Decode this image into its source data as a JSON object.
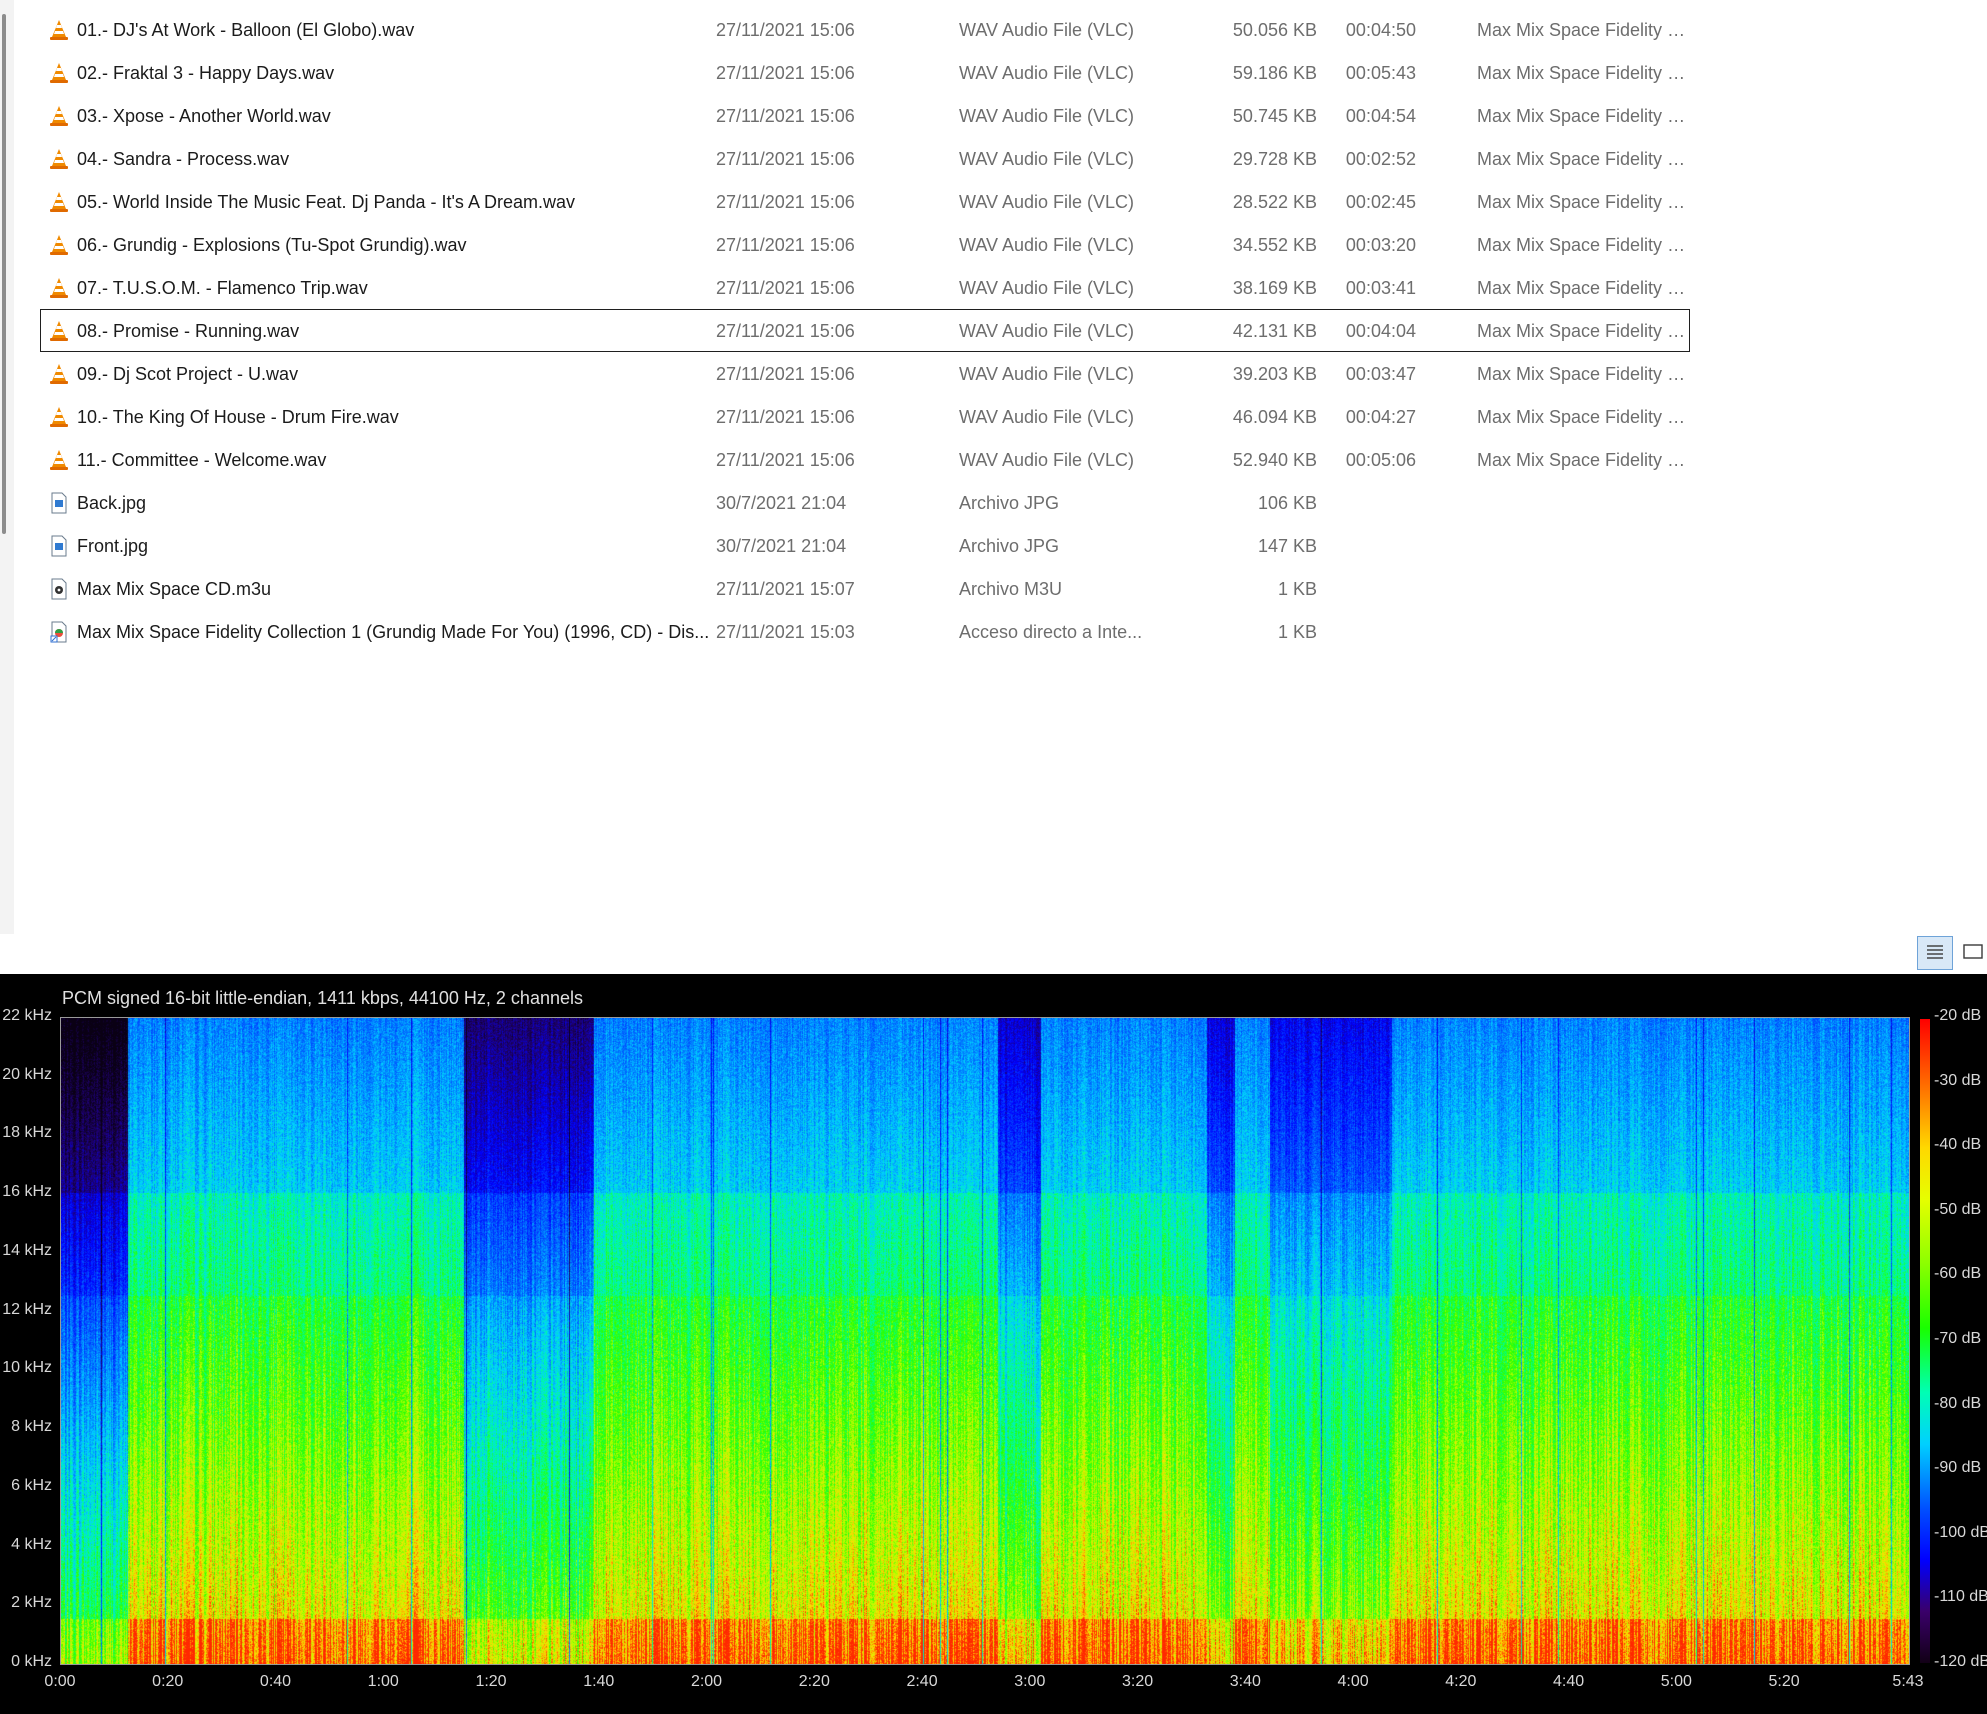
{
  "files": [
    {
      "icon": "vlc-cone-icon",
      "name": "01.- DJ's At Work - Balloon (El Globo).wav",
      "date": "27/11/2021 15:06",
      "type": "WAV Audio File (VLC)",
      "size": "50.056 KB",
      "duration": "00:04:50",
      "album": "Max Mix Space Fidelity C..."
    },
    {
      "icon": "vlc-cone-icon",
      "name": "02.- Fraktal 3 - Happy Days.wav",
      "date": "27/11/2021 15:06",
      "type": "WAV Audio File (VLC)",
      "size": "59.186 KB",
      "duration": "00:05:43",
      "album": "Max Mix Space Fidelity C..."
    },
    {
      "icon": "vlc-cone-icon",
      "name": "03.- Xpose - Another World.wav",
      "date": "27/11/2021 15:06",
      "type": "WAV Audio File (VLC)",
      "size": "50.745 KB",
      "duration": "00:04:54",
      "album": "Max Mix Space Fidelity C..."
    },
    {
      "icon": "vlc-cone-icon",
      "name": "04.- Sandra - Process.wav",
      "date": "27/11/2021 15:06",
      "type": "WAV Audio File (VLC)",
      "size": "29.728 KB",
      "duration": "00:02:52",
      "album": "Max Mix Space Fidelity C..."
    },
    {
      "icon": "vlc-cone-icon",
      "name": "05.- World Inside The Music Feat. Dj Panda - It's A Dream.wav",
      "date": "27/11/2021 15:06",
      "type": "WAV Audio File (VLC)",
      "size": "28.522 KB",
      "duration": "00:02:45",
      "album": "Max Mix Space Fidelity C..."
    },
    {
      "icon": "vlc-cone-icon",
      "name": "06.- Grundig - Explosions (Tu-Spot Grundig).wav",
      "date": "27/11/2021 15:06",
      "type": "WAV Audio File (VLC)",
      "size": "34.552 KB",
      "duration": "00:03:20",
      "album": "Max Mix Space Fidelity C..."
    },
    {
      "icon": "vlc-cone-icon",
      "name": "07.- T.U.S.O.M. - Flamenco Trip.wav",
      "date": "27/11/2021 15:06",
      "type": "WAV Audio File (VLC)",
      "size": "38.169 KB",
      "duration": "00:03:41",
      "album": "Max Mix Space Fidelity C..."
    },
    {
      "icon": "vlc-cone-icon",
      "name": "08.- Promise - Running.wav",
      "date": "27/11/2021 15:06",
      "type": "WAV Audio File (VLC)",
      "size": "42.131 KB",
      "duration": "00:04:04",
      "album": "Max Mix Space Fidelity C...",
      "selected": true
    },
    {
      "icon": "vlc-cone-icon",
      "name": "09.- Dj Scot Project - U.wav",
      "date": "27/11/2021 15:06",
      "type": "WAV Audio File (VLC)",
      "size": "39.203 KB",
      "duration": "00:03:47",
      "album": "Max Mix Space Fidelity C..."
    },
    {
      "icon": "vlc-cone-icon",
      "name": "10.- The King Of House - Drum Fire.wav",
      "date": "27/11/2021 15:06",
      "type": "WAV Audio File (VLC)",
      "size": "46.094 KB",
      "duration": "00:04:27",
      "album": "Max Mix Space Fidelity C..."
    },
    {
      "icon": "vlc-cone-icon",
      "name": "11.- Committee - Welcome.wav",
      "date": "27/11/2021 15:06",
      "type": "WAV Audio File (VLC)",
      "size": "52.940 KB",
      "duration": "00:05:06",
      "album": "Max Mix Space Fidelity C..."
    },
    {
      "icon": "image-file-icon",
      "name": "Back.jpg",
      "date": "30/7/2021 21:04",
      "type": "Archivo JPG",
      "size": "106 KB",
      "duration": "",
      "album": ""
    },
    {
      "icon": "image-file-icon",
      "name": "Front.jpg",
      "date": "30/7/2021 21:04",
      "type": "Archivo JPG",
      "size": "147 KB",
      "duration": "",
      "album": ""
    },
    {
      "icon": "playlist-file-icon",
      "name": "Max Mix Space CD.m3u",
      "date": "27/11/2021 15:07",
      "type": "Archivo M3U",
      "size": "1 KB",
      "duration": "",
      "album": ""
    },
    {
      "icon": "internet-shortcut-icon",
      "name": "Max Mix Space Fidelity Collection 1 (Grundig Made For You) (1996, CD) - Dis...",
      "date": "27/11/2021 15:03",
      "type": "Acceso directo a Inte...",
      "size": "1 KB",
      "duration": "",
      "album": ""
    }
  ],
  "view_buttons": {
    "details": "details-view-icon",
    "tiles": "tiles-view-icon"
  },
  "spectrogram": {
    "info": "PCM signed 16-bit little-endian, 1411 kbps, 44100 Hz, 2 channels",
    "y_ticks": [
      "22 kHz",
      "20 kHz",
      "18 kHz",
      "16 kHz",
      "14 kHz",
      "12 kHz",
      "10 kHz",
      "8 kHz",
      "6 kHz",
      "4 kHz",
      "2 kHz",
      "0 kHz"
    ],
    "x_ticks": [
      "0:00",
      "0:20",
      "0:40",
      "1:00",
      "1:20",
      "1:40",
      "2:00",
      "2:20",
      "2:40",
      "3:00",
      "3:20",
      "3:40",
      "4:00",
      "4:20",
      "4:40",
      "5:00",
      "5:20",
      "5:43"
    ],
    "db_ticks": [
      "-20 dB",
      "-30 dB",
      "-40 dB",
      "-50 dB",
      "-60 dB",
      "-70 dB",
      "-80 dB",
      "-90 dB",
      "-100 dB",
      "-110 dB",
      "-120 dB"
    ],
    "duration_seconds": 343,
    "max_khz": 22,
    "colors": {
      "background": "#000000",
      "high": "#ff0000",
      "mid": "#19ff00",
      "low": "#0000ff"
    }
  }
}
